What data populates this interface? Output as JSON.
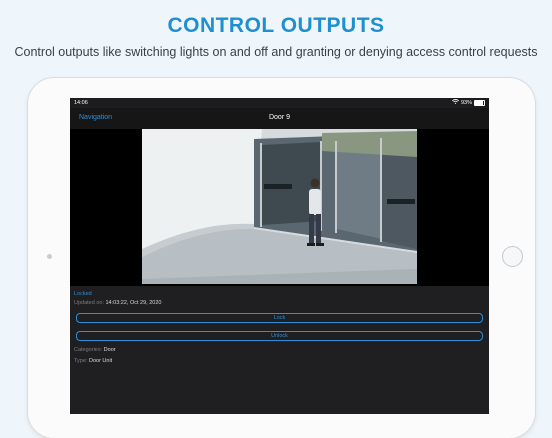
{
  "promo": {
    "headline": "CONTROL OUTPUTS",
    "subtitle": "Control outputs like switching lights on and off and granting or denying access control requests"
  },
  "statusbar": {
    "time": "14:06",
    "battery": "93%"
  },
  "navbar": {
    "back_label": "Navigation",
    "title": "Door 9"
  },
  "door": {
    "state": "Locked",
    "updated_label": "Updated on:",
    "updated_value": "14:03:22, Oct 29, 2020",
    "lock_label": "Lock",
    "unlock_label": "Unlock",
    "categories_label": "Categories:",
    "categories_value": "Door",
    "type_label": "Type:",
    "type_value": "Door Unit"
  },
  "colors": {
    "accent": "#2e8fd8",
    "headline": "#1f8fcf",
    "panel": "#1f1f21"
  }
}
